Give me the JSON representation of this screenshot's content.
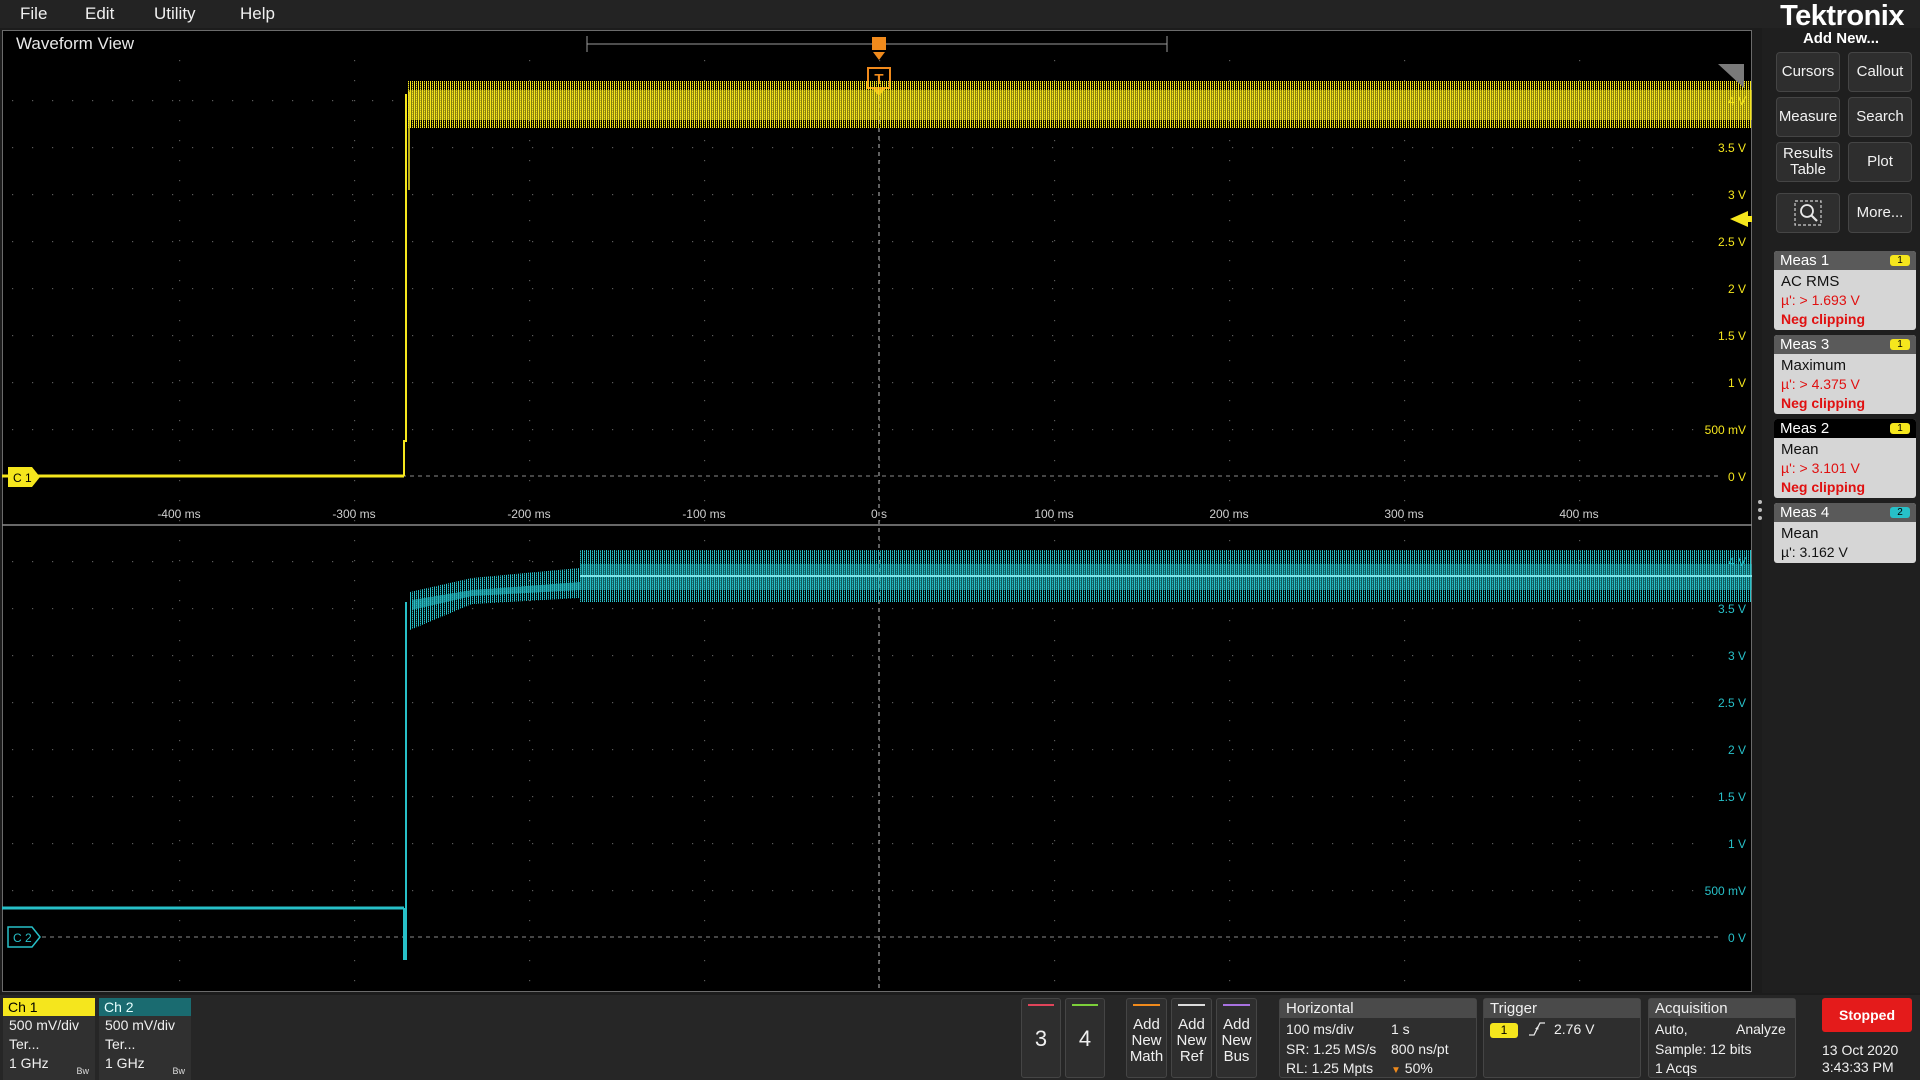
{
  "menu": {
    "items": [
      "File",
      "Edit",
      "Utility",
      "Help"
    ]
  },
  "brand": "Tektronix",
  "waveform_view": {
    "title": "Waveform View",
    "trigger_marker": "T",
    "ch1_marker": "C 1",
    "ch2_marker": "C 2",
    "ch1_voltage_labels": [
      "4 V",
      "3.5 V",
      "3 V",
      "2.5 V",
      "2 V",
      "1.5 V",
      "1 V",
      "500 mV",
      "0 V"
    ],
    "ch2_voltage_labels": [
      "4 V",
      "3.5 V",
      "3 V",
      "2.5 V",
      "2 V",
      "1.5 V",
      "1 V",
      "500 mV",
      "0 V"
    ],
    "time_labels": [
      "-400 ms",
      "-300 ms",
      "-200 ms",
      "-100 ms",
      "0 s",
      "100 ms",
      "200 ms",
      "300 ms",
      "400 ms"
    ],
    "colors": {
      "ch1": "#f5e61d",
      "ch2": "#27c0c8",
      "trigger": "#f08a1c"
    }
  },
  "right_panel": {
    "add_new_label": "Add New...",
    "buttons": [
      "Cursors",
      "Callout",
      "Measure",
      "Search",
      "Results Table",
      "Plot",
      "",
      "More..."
    ],
    "zoom_icon": "zoom-icon",
    "measurements": [
      {
        "title": "Meas 1",
        "badge": "1",
        "type": "AC RMS",
        "value": "µ': > 1.693 V",
        "warning": "Neg clipping",
        "selected": false
      },
      {
        "title": "Meas 3",
        "badge": "1",
        "type": "Maximum",
        "value": "µ': > 4.375 V",
        "warning": "Neg clipping",
        "selected": false
      },
      {
        "title": "Meas 2",
        "badge": "1",
        "type": "Mean",
        "value": "µ': > 3.101 V",
        "warning": "Neg clipping",
        "selected": true
      },
      {
        "title": "Meas 4",
        "badge": "2",
        "type": "Mean",
        "value": "µ': 3.162 V",
        "warning": "",
        "selected": false
      }
    ]
  },
  "bottom_bar": {
    "ch1": {
      "title": "Ch 1",
      "scale": "500 mV/div",
      "term": "Ter...",
      "bw": "1 GHz",
      "bw_flag": "Bw"
    },
    "ch2": {
      "title": "Ch 2",
      "scale": "500 mV/div",
      "term": "Ter...",
      "bw": "1 GHz",
      "bw_flag": "Bw"
    },
    "ch3_label": "3",
    "ch4_label": "4",
    "add_math": "Add New Math",
    "add_ref": "Add New Ref",
    "add_bus": "Add New Bus",
    "horizontal": {
      "title": "Horizontal",
      "scale": "100 ms/div",
      "duration": "1 s",
      "sample_rate": "SR: 1.25 MS/s",
      "resolution": "800 ns/pt",
      "record_length": "RL: 1.25 Mpts",
      "position": "50%"
    },
    "trigger": {
      "title": "Trigger",
      "source": "1",
      "level": "2.76 V"
    },
    "acquisition": {
      "title": "Acquisition",
      "mode": "Auto,",
      "action": "Analyze",
      "sample": "Sample: 12 bits",
      "acqs": "1 Acqs"
    },
    "status": "Stopped",
    "date": "13 Oct 2020",
    "time": "3:43:33 PM"
  }
}
